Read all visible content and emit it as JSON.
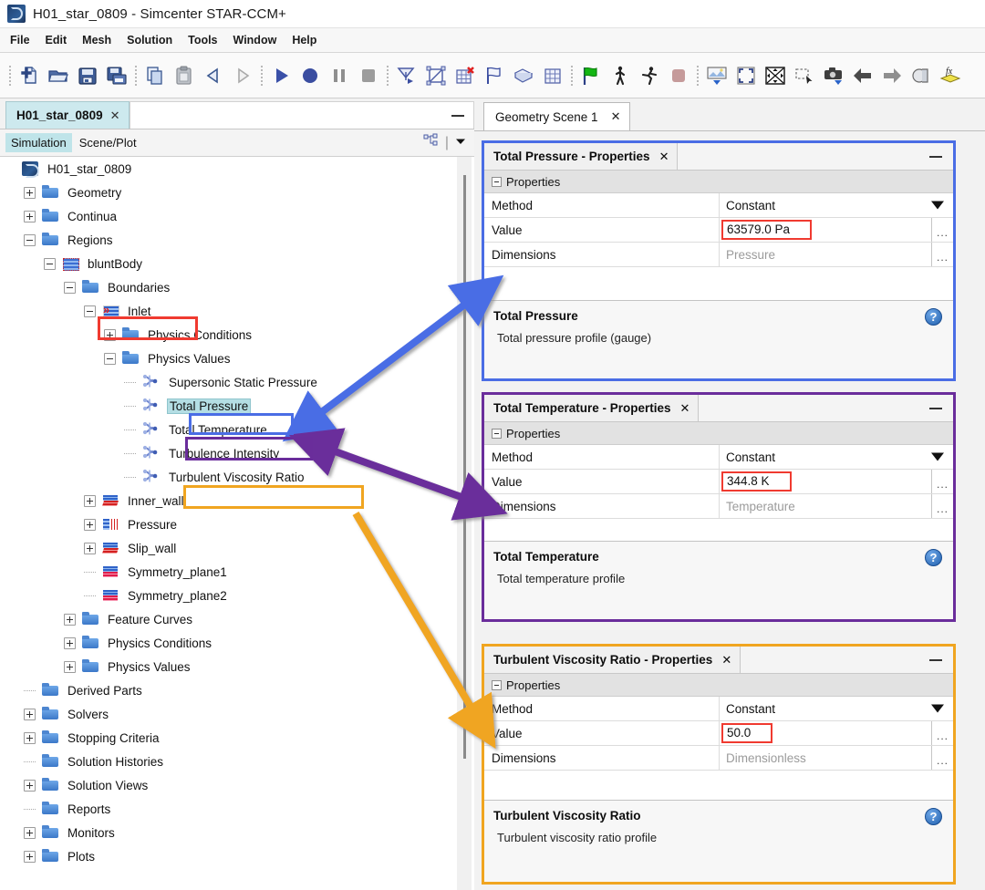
{
  "window": {
    "title": "H01_star_0809 - Simcenter STAR-CCM+",
    "logo_icon": "star-ccm-logo-icon"
  },
  "menubar": {
    "items": [
      {
        "label": "File"
      },
      {
        "label": "Edit"
      },
      {
        "label": "Mesh"
      },
      {
        "label": "Solution"
      },
      {
        "label": "Tools"
      },
      {
        "label": "Window"
      },
      {
        "label": "Help"
      }
    ]
  },
  "toolbar": {
    "groups": [
      {
        "buttons": [
          {
            "icon": "new-simulation-icon"
          },
          {
            "icon": "open-folder-icon"
          },
          {
            "icon": "save-icon"
          },
          {
            "icon": "save-all-icon"
          }
        ]
      },
      {
        "buttons": [
          {
            "icon": "copy-icon"
          },
          {
            "icon": "paste-icon"
          },
          {
            "icon": "undo-icon"
          },
          {
            "icon": "redo-icon"
          }
        ]
      },
      {
        "buttons": [
          {
            "icon": "run-play-icon"
          },
          {
            "icon": "step-circle-icon"
          },
          {
            "icon": "pause-icon"
          },
          {
            "icon": "stop-icon"
          }
        ]
      },
      {
        "buttons": [
          {
            "icon": "generate-surface-mesh-icon"
          },
          {
            "icon": "surface-repair-icon"
          },
          {
            "icon": "clear-mesh-icon"
          },
          {
            "icon": "flag-outline-icon"
          },
          {
            "icon": "surface-patch-icon"
          },
          {
            "icon": "volume-mesh-icon"
          }
        ]
      },
      {
        "buttons": [
          {
            "icon": "initialize-green-flag-icon"
          },
          {
            "icon": "step-walk-icon"
          },
          {
            "icon": "run-walk-icon"
          },
          {
            "icon": "stop-solver-icon"
          }
        ]
      },
      {
        "buttons": [
          {
            "icon": "scene-image-icon"
          },
          {
            "icon": "fit-view-icon"
          },
          {
            "icon": "reset-view-icon"
          },
          {
            "icon": "select-rectangle-icon"
          },
          {
            "icon": "hardcopy-camera-icon"
          },
          {
            "icon": "back-arrow-icon"
          },
          {
            "icon": "forward-arrow-icon"
          },
          {
            "icon": "transparency-icon"
          },
          {
            "icon": "field-function-icon"
          }
        ]
      }
    ]
  },
  "left_panel": {
    "window_tab": {
      "label": "H01_star_0809",
      "close_icon": "close-icon"
    },
    "minimize_icon": "minimize-icon",
    "sub_tabs": [
      {
        "label": "Simulation",
        "active": true
      },
      {
        "label": "Scene/Plot",
        "active": false
      }
    ],
    "tree_tools": [
      {
        "icon": "tree-hierarchy-icon"
      },
      {
        "icon": "chevron-down-icon"
      }
    ],
    "tree": [
      {
        "label": "H01_star_0809",
        "depth": 0,
        "toggle": "none",
        "icon": "simulation-root-icon"
      },
      {
        "label": "Geometry",
        "depth": 1,
        "toggle": "plus",
        "icon": "folder-icon"
      },
      {
        "label": "Continua",
        "depth": 1,
        "toggle": "plus",
        "icon": "folder-icon"
      },
      {
        "label": "Regions",
        "depth": 1,
        "toggle": "minus",
        "icon": "folder-icon"
      },
      {
        "label": "bluntBody",
        "depth": 2,
        "toggle": "minus",
        "icon": "region-icon"
      },
      {
        "label": "Boundaries",
        "depth": 3,
        "toggle": "minus",
        "icon": "folder-icon"
      },
      {
        "label": "Inlet",
        "depth": 4,
        "toggle": "minus",
        "icon": "inlet-boundary-icon",
        "annotation": "red"
      },
      {
        "label": "Physics Conditions",
        "depth": 5,
        "toggle": "plus",
        "icon": "folder-icon"
      },
      {
        "label": "Physics Values",
        "depth": 5,
        "toggle": "minus",
        "icon": "folder-icon"
      },
      {
        "label": "Supersonic Static Pressure",
        "depth": 6,
        "toggle": "leaf",
        "icon": "profile-icon"
      },
      {
        "label": "Total Pressure",
        "depth": 6,
        "toggle": "leaf",
        "icon": "profile-icon",
        "selected": true,
        "annotation": "blue"
      },
      {
        "label": "Total Temperature",
        "depth": 6,
        "toggle": "leaf",
        "icon": "profile-icon",
        "annotation": "purple"
      },
      {
        "label": "Turbulence Intensity",
        "depth": 6,
        "toggle": "leaf",
        "icon": "profile-icon"
      },
      {
        "label": "Turbulent Viscosity Ratio",
        "depth": 6,
        "toggle": "leaf",
        "icon": "profile-icon",
        "annotation": "orange"
      },
      {
        "label": "Inner_wall",
        "depth": 4,
        "toggle": "plus",
        "icon": "wall-boundary-icon"
      },
      {
        "label": "Pressure",
        "depth": 4,
        "toggle": "plus",
        "icon": "pressure-boundary-icon"
      },
      {
        "label": "Slip_wall",
        "depth": 4,
        "toggle": "plus",
        "icon": "wall-boundary-icon"
      },
      {
        "label": "Symmetry_plane1",
        "depth": 4,
        "toggle": "leaf",
        "icon": "symmetry-boundary-icon"
      },
      {
        "label": "Symmetry_plane2",
        "depth": 4,
        "toggle": "leaf",
        "icon": "symmetry-boundary-icon"
      },
      {
        "label": "Feature Curves",
        "depth": 3,
        "toggle": "plus",
        "icon": "folder-icon"
      },
      {
        "label": "Physics Conditions",
        "depth": 3,
        "toggle": "plus",
        "icon": "folder-icon"
      },
      {
        "label": "Physics Values",
        "depth": 3,
        "toggle": "plus",
        "icon": "folder-icon"
      },
      {
        "label": "Derived Parts",
        "depth": 1,
        "toggle": "leaf",
        "icon": "folder-icon"
      },
      {
        "label": "Solvers",
        "depth": 1,
        "toggle": "plus",
        "icon": "folder-icon"
      },
      {
        "label": "Stopping Criteria",
        "depth": 1,
        "toggle": "plus",
        "icon": "folder-icon"
      },
      {
        "label": "Solution Histories",
        "depth": 1,
        "toggle": "leaf",
        "icon": "folder-icon"
      },
      {
        "label": "Solution Views",
        "depth": 1,
        "toggle": "plus",
        "icon": "folder-icon"
      },
      {
        "label": "Reports",
        "depth": 1,
        "toggle": "leaf",
        "icon": "folder-icon"
      },
      {
        "label": "Monitors",
        "depth": 1,
        "toggle": "plus",
        "icon": "folder-icon"
      },
      {
        "label": "Plots",
        "depth": 1,
        "toggle": "plus",
        "icon": "folder-icon"
      }
    ]
  },
  "right_panel": {
    "scene_tab": {
      "label": "Geometry Scene 1",
      "close_icon": "close-icon"
    },
    "property_windows": [
      {
        "id": "total-pressure",
        "title": "Total Pressure - Properties",
        "close_icon": "close-icon",
        "minimize_icon": "minimize-icon",
        "border_color": "#4a6de5",
        "section_label": "Properties",
        "rows": [
          {
            "key": "Method",
            "value": "Constant",
            "kind": "dropdown"
          },
          {
            "key": "Value",
            "value": "63579.0 Pa",
            "kind": "highlighted",
            "ellipsis": "..."
          },
          {
            "key": "Dimensions",
            "value": "Pressure",
            "kind": "readonly",
            "ellipsis": "..."
          }
        ],
        "description_title": "Total Pressure",
        "description_text": "Total pressure profile (gauge)",
        "help_icon": "help-icon",
        "help_label": "?"
      },
      {
        "id": "total-temperature",
        "title": "Total Temperature - Properties",
        "close_icon": "close-icon",
        "minimize_icon": "minimize-icon",
        "border_color": "#6a2d9b",
        "section_label": "Properties",
        "rows": [
          {
            "key": "Method",
            "value": "Constant",
            "kind": "dropdown"
          },
          {
            "key": "Value",
            "value": "344.8 K",
            "kind": "highlighted",
            "ellipsis": "..."
          },
          {
            "key": "Dimensions",
            "value": "Temperature",
            "kind": "readonly",
            "ellipsis": "..."
          }
        ],
        "description_title": "Total Temperature",
        "description_text": "Total temperature profile",
        "help_icon": "help-icon",
        "help_label": "?"
      },
      {
        "id": "turbulent-viscosity-ratio",
        "title": "Turbulent Viscosity Ratio - Properties",
        "close_icon": "close-icon",
        "minimize_icon": "minimize-icon",
        "border_color": "#f0a520",
        "section_label": "Properties",
        "rows": [
          {
            "key": "Method",
            "value": "Constant",
            "kind": "dropdown"
          },
          {
            "key": "Value",
            "value": "50.0",
            "kind": "highlighted",
            "ellipsis": "..."
          },
          {
            "key": "Dimensions",
            "value": "Dimensionless",
            "kind": "readonly",
            "ellipsis": "..."
          }
        ],
        "description_title": "Turbulent Viscosity Ratio",
        "description_text": "Turbulent viscosity ratio profile",
        "help_icon": "help-icon",
        "help_label": "?"
      }
    ]
  },
  "annotations": {
    "highlight_colors": {
      "red": "#f03a30",
      "blue": "#4a6de5",
      "purple": "#6a2d9b",
      "orange": "#f0a520"
    },
    "arrows": [
      {
        "name": "total-pressure-arrow",
        "color": "#4a6de5"
      },
      {
        "name": "total-temperature-arrow",
        "color": "#6a2d9b"
      },
      {
        "name": "turbulent-viscosity-ratio-arrow",
        "color": "#f0a520"
      }
    ]
  }
}
